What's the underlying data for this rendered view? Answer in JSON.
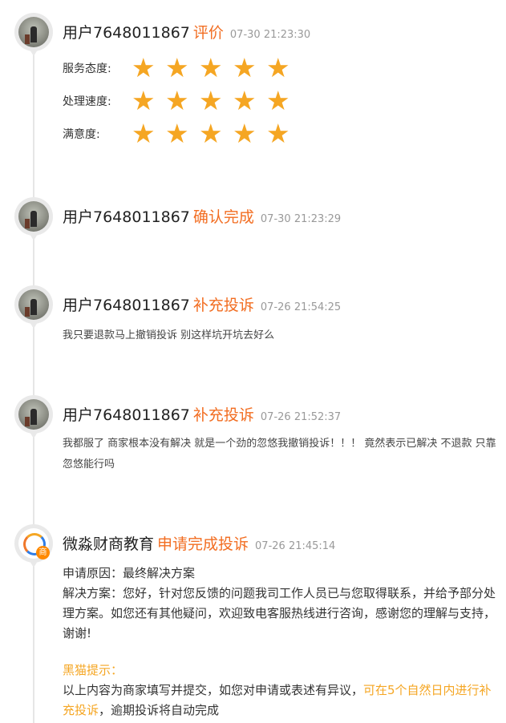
{
  "entries": [
    {
      "user": "用户7648011867",
      "action": "评价",
      "time": "07-30 21:23:30",
      "ratings": [
        {
          "label": "服务态度:",
          "stars": 5
        },
        {
          "label": "处理速度:",
          "stars": 5
        },
        {
          "label": "满意度:",
          "stars": 5
        }
      ]
    },
    {
      "user": "用户7648011867",
      "action": "确认完成",
      "time": "07-30 21:23:29"
    },
    {
      "user": "用户7648011867",
      "action": "补充投诉",
      "time": "07-26 21:54:25",
      "message": "我只要退款马上撤销投诉 别这样坑开坑去好么"
    },
    {
      "user": "用户7648011867",
      "action": "补充投诉",
      "time": "07-26 21:52:37",
      "message": "我都服了 商家根本没有解决 就是一个劲的忽悠我撤销投诉！！！ 竟然表示已解决 不退款 只靠忽悠能行吗"
    },
    {
      "user": "微淼财商教育",
      "action": "申请完成投诉",
      "time": "07-26 21:45:14",
      "badge": "商",
      "reason": "申请原因：最终解决方案",
      "solution": "解决方案：您好，针对您反馈的问题我司工作人员已与您取得联系，并给予部分处理方案。如您还有其他疑问，欢迎致电客服热线进行咨询，感谢您的理解与支持，谢谢!",
      "tip_title": "黑猫提示：",
      "tip_text": "以上内容为商家填写并提交，如您对申请或表述有异议，",
      "tip_highlight": "可在5个自然日内进行补充投诉",
      "tip_tail": "，逾期投诉将自动完成"
    }
  ],
  "icons": {
    "star": "star-icon"
  },
  "colors": {
    "action": "#f26d21",
    "star": "#f5a623",
    "tip": "#f5a623",
    "time": "#999999"
  }
}
